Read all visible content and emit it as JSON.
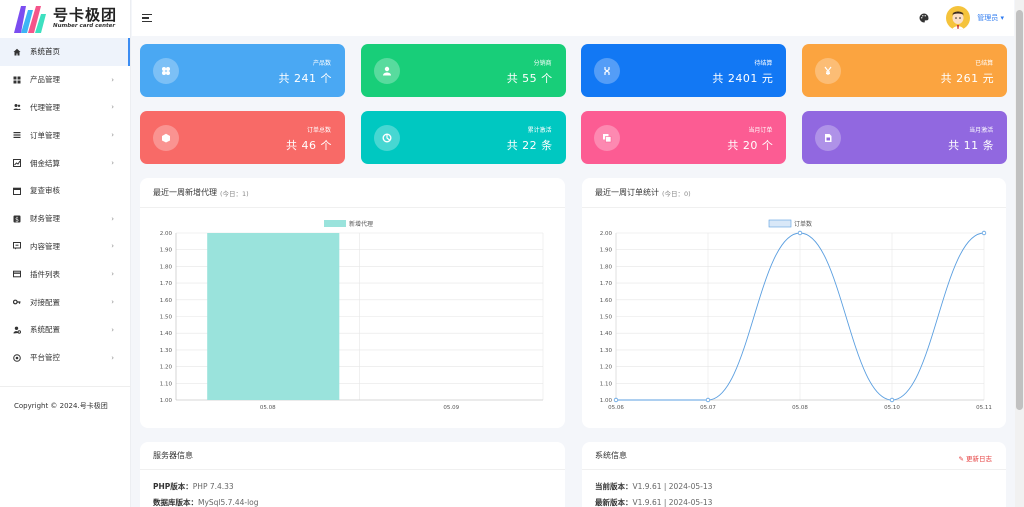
{
  "brand": {
    "title": "号卡极团",
    "subtitle": "Number card center"
  },
  "menu": [
    {
      "label": "系统首页",
      "icon": "home-icon",
      "active": true,
      "chevron": false
    },
    {
      "label": "产品管理",
      "icon": "grid-icon",
      "chevron": true
    },
    {
      "label": "代理管理",
      "icon": "users-icon",
      "chevron": true
    },
    {
      "label": "订单管理",
      "icon": "list-icon",
      "chevron": true
    },
    {
      "label": "佣金结算",
      "icon": "chart-icon",
      "chevron": true
    },
    {
      "label": "复查审核",
      "icon": "calendar-icon",
      "chevron": false
    },
    {
      "label": "财务管理",
      "icon": "dollar-icon",
      "chevron": true
    },
    {
      "label": "内容管理",
      "icon": "message-icon",
      "chevron": true
    },
    {
      "label": "插件列表",
      "icon": "card-icon",
      "chevron": true
    },
    {
      "label": "对接配置",
      "icon": "key-icon",
      "chevron": true
    },
    {
      "label": "系统配置",
      "icon": "user-gear-icon",
      "chevron": true
    },
    {
      "label": "平台管控",
      "icon": "shield-icon",
      "chevron": true
    }
  ],
  "copyright": "Copyright © 2024.号卡极团",
  "topbar": {
    "admin_label": "管理员",
    "chevron": "▾"
  },
  "stats": [
    {
      "label": "产品数",
      "value": "共 241 个",
      "color": "#4aa8f3",
      "icon": "apps-icon"
    },
    {
      "label": "分销商",
      "value": "共 55 个",
      "color": "#18ce79",
      "icon": "user-icon"
    },
    {
      "label": "待结算",
      "value": "共 2401 元",
      "color": "#1278f4",
      "icon": "pending-icon"
    },
    {
      "label": "已结算",
      "value": "共 261 元",
      "color": "#fba440",
      "icon": "yen-icon"
    },
    {
      "label": "订单总数",
      "value": "共 46 个",
      "color": "#f86a67",
      "icon": "box-icon"
    },
    {
      "label": "累计激活",
      "value": "共 22 条",
      "color": "#00c8c1",
      "icon": "activate-icon"
    },
    {
      "label": "当月订单",
      "value": "共 20 个",
      "color": "#fc5c93",
      "icon": "copy-icon"
    },
    {
      "label": "当月激活",
      "value": "共 11 条",
      "color": "#9168e0",
      "icon": "sim-icon"
    }
  ],
  "chart_agents": {
    "title": "最近一周新增代理",
    "subtitle": "(今日：1)",
    "chart_data": {
      "type": "bar",
      "categories": [
        "05.08",
        "05.09"
      ],
      "series": [
        {
          "name": "新增代理",
          "values": [
            2,
            0
          ]
        }
      ],
      "ylim": [
        1.0,
        2.0
      ],
      "yticks": [
        "2.00",
        "1.90",
        "1.80",
        "1.70",
        "1.60",
        "1.50",
        "1.40",
        "1.30",
        "1.20",
        "1.10",
        "1.00"
      ],
      "color": "#9ae3dc",
      "grid": true,
      "legend": "top"
    }
  },
  "chart_orders": {
    "title": "最近一周订单统计",
    "subtitle": "(今日：0)",
    "chart_data": {
      "type": "line",
      "x": [
        "05.06",
        "05.07",
        "05.08",
        "05.10",
        "05.11"
      ],
      "series": [
        {
          "name": "订单数",
          "values": [
            1,
            1,
            2,
            1,
            2
          ]
        }
      ],
      "ylim": [
        1.0,
        2.0
      ],
      "yticks": [
        "2.00",
        "1.90",
        "1.80",
        "1.70",
        "1.60",
        "1.50",
        "1.40",
        "1.30",
        "1.20",
        "1.10",
        "1.00"
      ],
      "color": "#5b9fe0",
      "grid": true,
      "legend": "top"
    }
  },
  "server": {
    "title": "服务器信息",
    "rows": [
      {
        "label": "PHP版本：",
        "value": "PHP 7.4.33"
      },
      {
        "label": "数据库版本：",
        "value": "MySql5.7.44-log"
      }
    ]
  },
  "system": {
    "title": "系统信息",
    "log_button": "更新日志",
    "rows": [
      {
        "label": "当前版本：",
        "value": "V1.9.61 | 2024-05-13"
      },
      {
        "label": "最新版本：",
        "value": "V1.9.61 | 2024-05-13"
      }
    ]
  }
}
